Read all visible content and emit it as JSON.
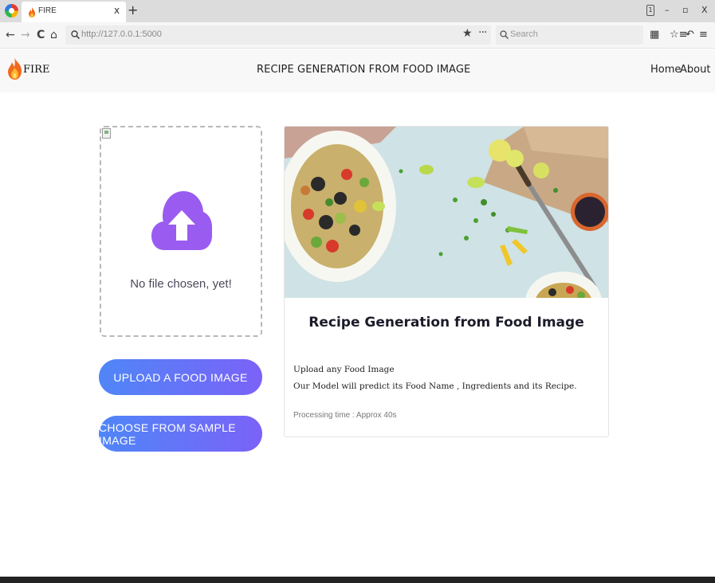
{
  "browser": {
    "tab_title": "FIRE",
    "tab_close": "x",
    "new_tab": "+",
    "window_badge": "1",
    "minimize": "–",
    "restore": "▫",
    "close": "X",
    "back": "←",
    "forward": "→",
    "reload": "C",
    "home": "⌂",
    "url": "http://127.0.0.1:5000",
    "bookmark_star": "★",
    "page_actions": "···",
    "search_placeholder": "Search",
    "library": "▦",
    "bookmarks_menu": "☆≡",
    "undo": "↶",
    "menu": "≡"
  },
  "header": {
    "brand": "FIRE",
    "title": "RECIPE GENERATION FROM FOOD IMAGE",
    "nav": [
      {
        "label": "Home"
      },
      {
        "label": "About"
      }
    ]
  },
  "upload": {
    "status": "No file chosen, yet!",
    "icon": "cloud-upload-icon"
  },
  "buttons": {
    "upload": "UPLOAD A FOOD IMAGE",
    "sample": "CHOOSE FROM SAMPLE IMAGE"
  },
  "card": {
    "title": "Recipe Generation from Food Image",
    "line1": "Upload any Food Image",
    "line2": "Our Model will predict its Food Name , Ingredients and its Recipe.",
    "note": "Processing time : Approx 40s"
  },
  "colors": {
    "button_gradient_start": "#4f86f7",
    "button_gradient_end": "#7b62f8",
    "upload_icon": "#9a5cf0"
  }
}
